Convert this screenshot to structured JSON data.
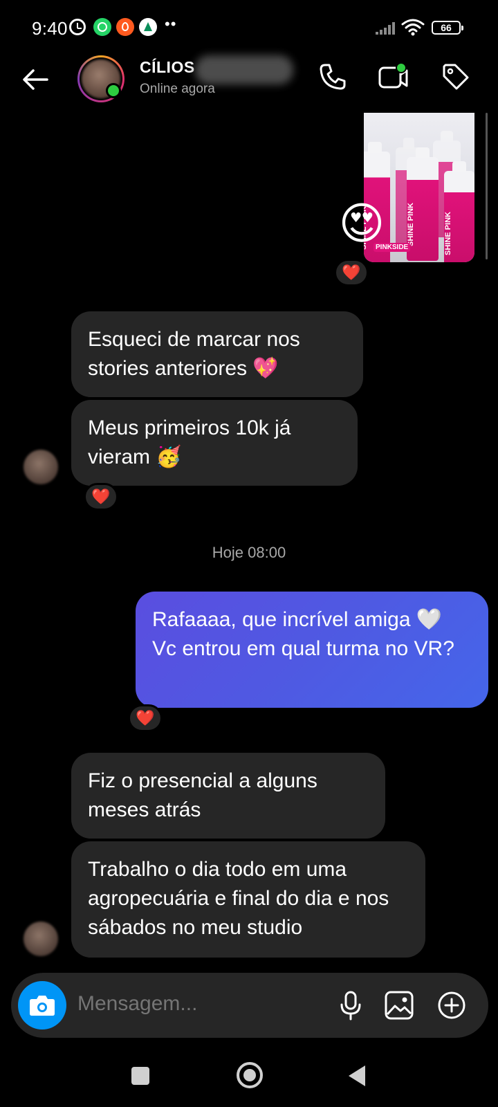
{
  "status_bar": {
    "time": "9:40",
    "dots": "••",
    "battery": "66"
  },
  "header": {
    "contact_name": "CÍLIOS",
    "status": "Online agora"
  },
  "image_message": {
    "product_label": "SHINE PINK",
    "brand": "PINKSIDE",
    "reaction_emoji": "😍",
    "reaction": "❤️"
  },
  "messages": [
    {
      "direction": "received",
      "text": "Esqueci de marcar nos stories anteriores 💖"
    },
    {
      "direction": "received",
      "text": "Meus primeiros 10k já vieram 🥳",
      "reaction": "❤️"
    },
    {
      "direction": "sent",
      "text": "Rafaaaa, que incrível amiga 🤍 Vc entrou em qual turma no VR?",
      "reaction": "❤️"
    },
    {
      "direction": "received",
      "text": "Fiz o presencial a alguns meses atrás"
    },
    {
      "direction": "received",
      "text": "Trabalho o dia todo em uma agropecuária e final do dia e nos sábados no meu studio"
    }
  ],
  "date_separator": "Hoje 08:00",
  "composer": {
    "placeholder": "Mensagem..."
  },
  "colors": {
    "background": "#000000",
    "received_bubble": "#262626",
    "sent_bubble": "#5a4ee0",
    "camera_button": "#0095f6",
    "online": "#2ecc40",
    "heart": "#ed1f3b"
  }
}
